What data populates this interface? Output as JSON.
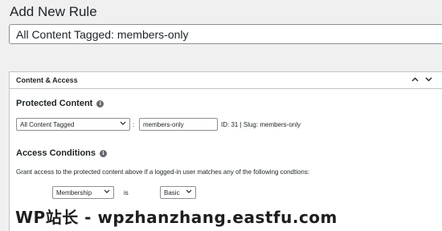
{
  "page": {
    "title": "Add New Rule"
  },
  "rule_title": {
    "value": "All Content Tagged: members-only"
  },
  "metabox": {
    "title": "Content & Access",
    "controls": {
      "up_icon": "chevron-up-icon",
      "down_icon": "chevron-down-icon"
    }
  },
  "protected_content": {
    "heading": "Protected Content",
    "type_select": "All Content Tagged",
    "separator": ":",
    "tag_value": "members-only",
    "id_slug": "ID: 31 | Slug: members-only"
  },
  "access_conditions": {
    "heading": "Access Conditions",
    "description": "Grant access to the protected content above if a logged-in user matches any of the following condtions:",
    "condition": {
      "field_select": "Membership",
      "operator": "is",
      "value_select": "Basic"
    }
  },
  "watermark": {
    "text": "WP站长 - wpzhanzhang.eastfu.com"
  }
}
